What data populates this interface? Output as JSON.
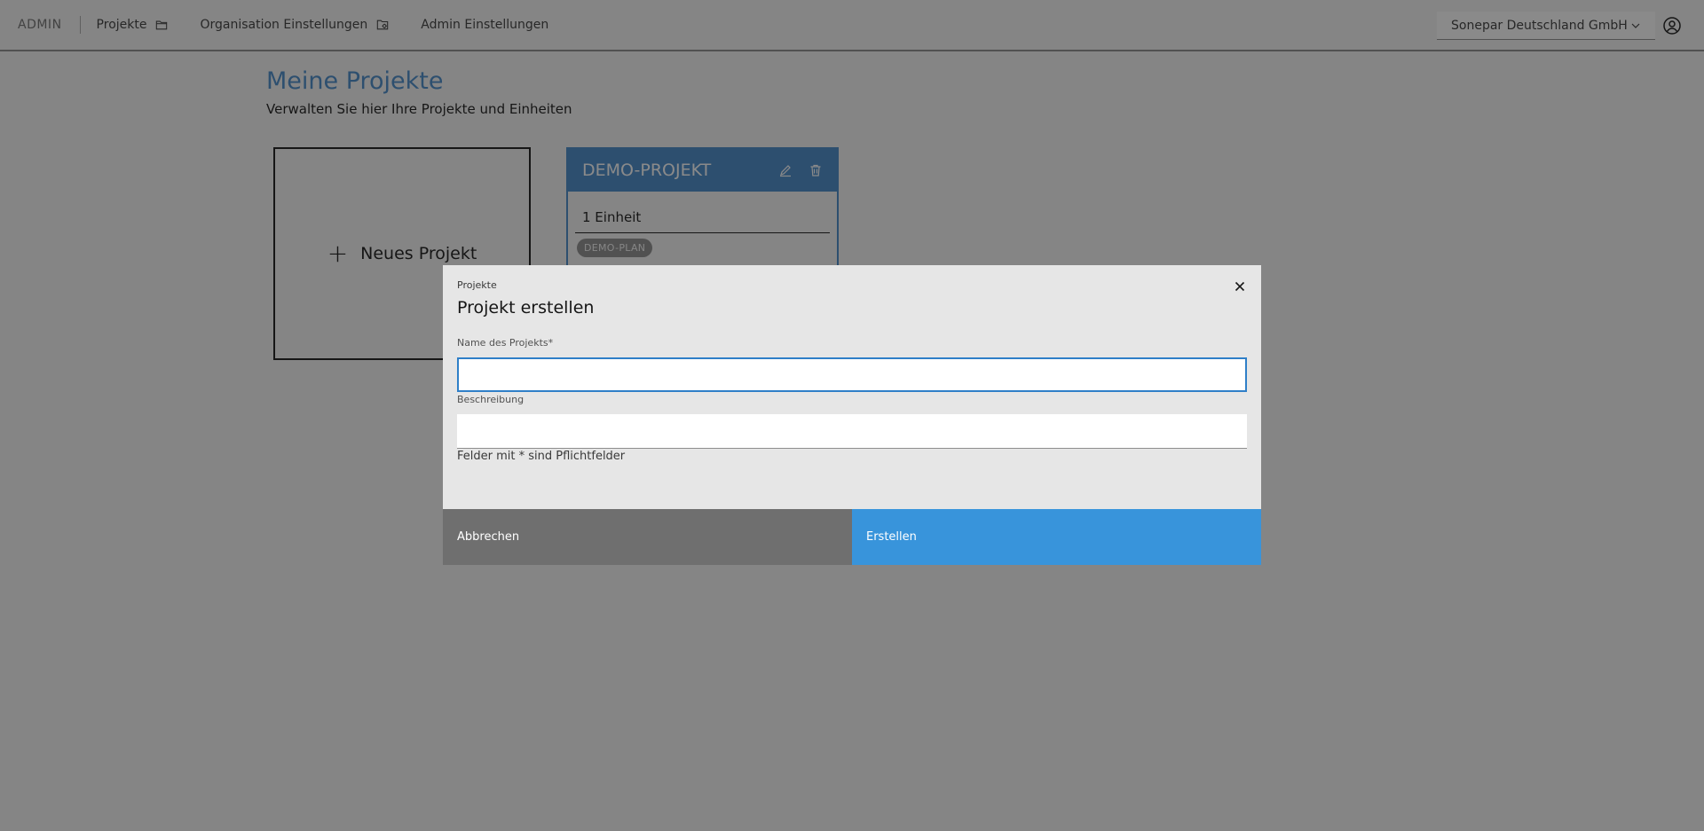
{
  "nav": {
    "brand": "ADMIN",
    "items": [
      {
        "label": "Projekte",
        "icon": "folder-icon"
      },
      {
        "label": "Organisation Einstellungen",
        "icon": "folder-settings-icon"
      },
      {
        "label": "Admin Einstellungen"
      }
    ],
    "org_select": "Sonepar Deutschland GmbH",
    "user_icon": "user-avatar-icon"
  },
  "page": {
    "title": "Meine Projekte",
    "subtitle": "Verwalten Sie hier Ihre Projekte und Einheiten",
    "new_project_label": "Neues Projekt",
    "projects": [
      {
        "name": "DEMO-PROJEKT",
        "units": "1 Einheit",
        "tag": "DEMO-PLAN"
      }
    ]
  },
  "modal": {
    "overline": "Projekte",
    "title": "Projekt erstellen",
    "name_label": "Name des Projekts*",
    "name_value": "",
    "description_label": "Beschreibung",
    "description_value": "",
    "hint": "Felder mit * sind Pflichtfelder",
    "cancel_label": "Abbrechen",
    "create_label": "Erstellen"
  },
  "colors": {
    "accent": "#4589c9",
    "primary_button": "#3894db",
    "secondary_button": "#6f6f6f"
  }
}
